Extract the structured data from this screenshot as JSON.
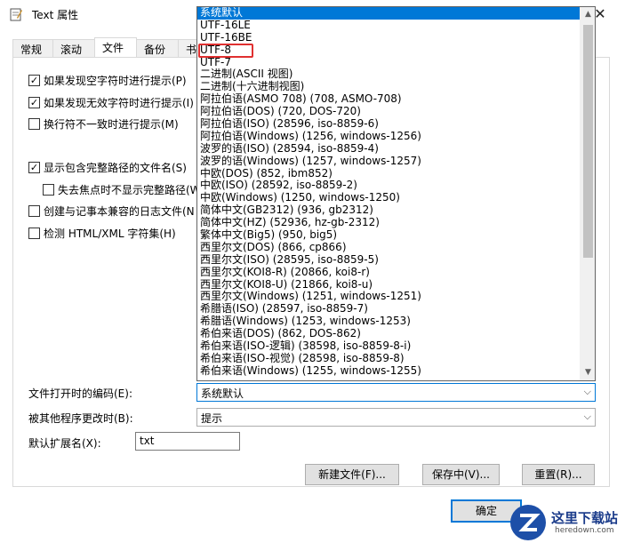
{
  "window": {
    "title": "Text 属性",
    "close_glyph": "✕"
  },
  "tabs": [
    "常规",
    "滚动",
    "文件",
    "备份",
    "书"
  ],
  "checkboxes": [
    {
      "label": "如果发现空字符时进行提示(P)",
      "checked": true
    },
    {
      "label": "如果发现无效字符时进行提示(I)",
      "checked": true
    },
    {
      "label": "换行符不一致时进行提示(M)",
      "checked": false
    },
    {
      "label": "显示包含完整路径的文件名(S)",
      "checked": true
    },
    {
      "label": "失去焦点时不显示完整路径(W",
      "checked": false
    },
    {
      "label": "创建与记事本兼容的日志文件(N",
      "checked": false
    },
    {
      "label": "检测 HTML/XML 字符集(H)",
      "checked": false
    }
  ],
  "encoding": {
    "label": "文件打开时的编码(E):",
    "value": "系统默认"
  },
  "changed_by_other": {
    "label": "被其他程序更改时(B):",
    "value": "提示"
  },
  "default_ext": {
    "label": "默认扩展名(X):",
    "value": "txt"
  },
  "buttons": {
    "new_file": "新建文件(F)...",
    "save_as": "保存中(V)...",
    "reset": "重置(R)...",
    "ok": "确定"
  },
  "dropdown_options": [
    "系统默认",
    "UTF-16LE",
    "UTF-16BE",
    "UTF-8",
    "UTF-7",
    "二进制(ASCII 视图)",
    "二进制(十六进制视图)",
    "阿拉伯语(ASMO 708) (708, ASMO-708)",
    "阿拉伯语(DOS) (720, DOS-720)",
    "阿拉伯语(ISO) (28596, iso-8859-6)",
    "阿拉伯语(Windows) (1256, windows-1256)",
    "波罗的语(ISO) (28594, iso-8859-4)",
    "波罗的语(Windows) (1257, windows-1257)",
    "中欧(DOS) (852, ibm852)",
    "中欧(ISO) (28592, iso-8859-2)",
    "中欧(Windows) (1250, windows-1250)",
    "简体中文(GB2312) (936, gb2312)",
    "简体中文(HZ) (52936, hz-gb-2312)",
    "繁体中文(Big5) (950, big5)",
    "西里尔文(DOS) (866, cp866)",
    "西里尔文(ISO) (28595, iso-8859-5)",
    "西里尔文(KOI8-R) (20866, koi8-r)",
    "西里尔文(KOI8-U) (21866, koi8-u)",
    "西里尔文(Windows) (1251, windows-1251)",
    "希腊语(ISO) (28597, iso-8859-7)",
    "希腊语(Windows) (1253, windows-1253)",
    "希伯来语(DOS) (862, DOS-862)",
    "希伯来语(ISO-逻辑) (38598, iso-8859-8-i)",
    "希伯来语(ISO-视觉) (28598, iso-8859-8)",
    "希伯来语(Windows) (1255, windows-1255)"
  ],
  "dropdown_selected_index": 0,
  "watermark": {
    "name": "这里下载站",
    "url": "heredown.com"
  },
  "colors": {
    "selection": "#0078d7",
    "highlight_box": "#e03030"
  }
}
